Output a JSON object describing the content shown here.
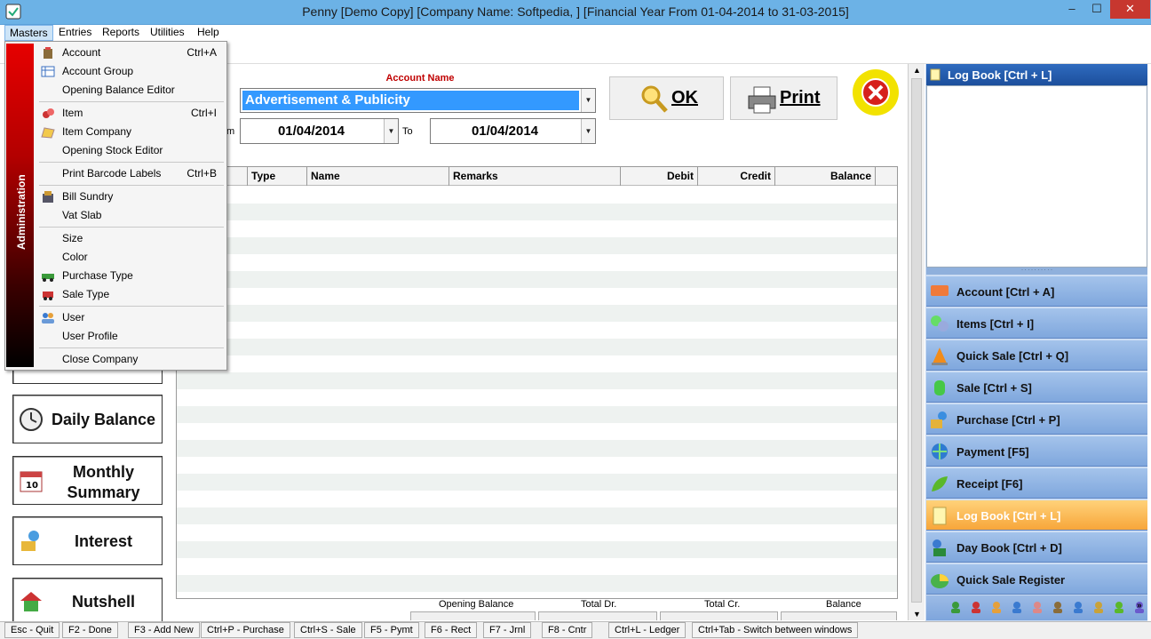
{
  "window": {
    "title": "Penny [Demo Copy] [Company Name: Softpedia, ] [Financial Year From 01-04-2014 to 31-03-2015]",
    "minimize": "–",
    "maximize": "☐",
    "close": "✕"
  },
  "menubar": [
    "Masters",
    "Entries",
    "Reports",
    "Utilities",
    "Help"
  ],
  "masters_menu": {
    "side_label": "Administration",
    "items": [
      {
        "label": "Account",
        "shortcut": "Ctrl+A",
        "icon": "account-icon"
      },
      {
        "label": "Account Group",
        "shortcut": "",
        "icon": "account-group-icon"
      },
      {
        "label": "Opening Balance Editor",
        "shortcut": "",
        "icon": ""
      },
      {
        "label": "Item",
        "shortcut": "Ctrl+I",
        "icon": "item-icon"
      },
      {
        "label": "Item Company",
        "shortcut": "",
        "icon": "item-company-icon"
      },
      {
        "label": "Opening Stock Editor",
        "shortcut": "",
        "icon": ""
      },
      {
        "label": "Print Barcode Labels",
        "shortcut": "Ctrl+B",
        "icon": ""
      },
      {
        "label": "Bill Sundry",
        "shortcut": "",
        "icon": "bill-sundry-icon"
      },
      {
        "label": "Vat Slab",
        "shortcut": "",
        "icon": ""
      },
      {
        "label": "Size",
        "shortcut": "",
        "icon": ""
      },
      {
        "label": "Color",
        "shortcut": "",
        "icon": ""
      },
      {
        "label": "Purchase Type",
        "shortcut": "",
        "icon": "purchase-type-icon"
      },
      {
        "label": "Sale Type",
        "shortcut": "",
        "icon": "sale-type-icon"
      },
      {
        "label": "User",
        "shortcut": "",
        "icon": "user-icon"
      },
      {
        "label": "User Profile",
        "shortcut": "",
        "icon": ""
      },
      {
        "label": "Close Company",
        "shortcut": "",
        "icon": ""
      }
    ]
  },
  "ledger": {
    "account_name_label": "Account Name",
    "account_value": "Advertisement & Publicity",
    "from_label": "m",
    "from_date": "01/04/2014",
    "to_label": "To",
    "to_date": "01/04/2014",
    "ok_label": "OK",
    "print_label": "Print",
    "columns": [
      "Type",
      "Name",
      "Remarks",
      "Debit",
      "Credit",
      "Balance"
    ],
    "footer": [
      "Opening Balance",
      "Total Dr.",
      "Total Cr.",
      "Balance"
    ]
  },
  "left_buttons": [
    "Daily Balance",
    "Monthly Summary",
    "Interest",
    "Nutshell"
  ],
  "right_panel": {
    "log_book_title": "Log Book [Ctrl + L]",
    "nav": [
      {
        "label": "Account [Ctrl + A]",
        "icon": "account-nav-icon",
        "active": false
      },
      {
        "label": "Items [Ctrl + I]",
        "icon": "items-nav-icon",
        "active": false
      },
      {
        "label": "Quick Sale [Ctrl + Q]",
        "icon": "cone-icon",
        "active": false
      },
      {
        "label": "Sale [Ctrl + S]",
        "icon": "cylinder-icon",
        "active": false
      },
      {
        "label": "Purchase [Ctrl + P]",
        "icon": "purchase-nav-icon",
        "active": false
      },
      {
        "label": "Payment [F5]",
        "icon": "globe-icon",
        "active": false
      },
      {
        "label": "Receipt [F6]",
        "icon": "leaf-icon",
        "active": false
      },
      {
        "label": "Log Book [Ctrl + L]",
        "icon": "notepad-icon",
        "active": true
      },
      {
        "label": "Day Book [Ctrl + D]",
        "icon": "daybook-icon",
        "active": false
      },
      {
        "label": "Quick Sale Register",
        "icon": "register-icon",
        "active": false
      }
    ]
  },
  "statusbar": [
    "Esc - Quit",
    "F2 - Done",
    "F3 - Add New",
    "Ctrl+P - Purchase",
    "Ctrl+S - Sale",
    "F5 - Pymt",
    "F6 - Rect",
    "F7 - Jrnl",
    "F8 - Cntr",
    "Ctrl+L - Ledger",
    "Ctrl+Tab - Switch between windows"
  ],
  "colors": {
    "accent": "#3399ff",
    "title_bar": "#6cb2e6",
    "account_label": "#c00000",
    "active_nav": "#f7a63a"
  }
}
